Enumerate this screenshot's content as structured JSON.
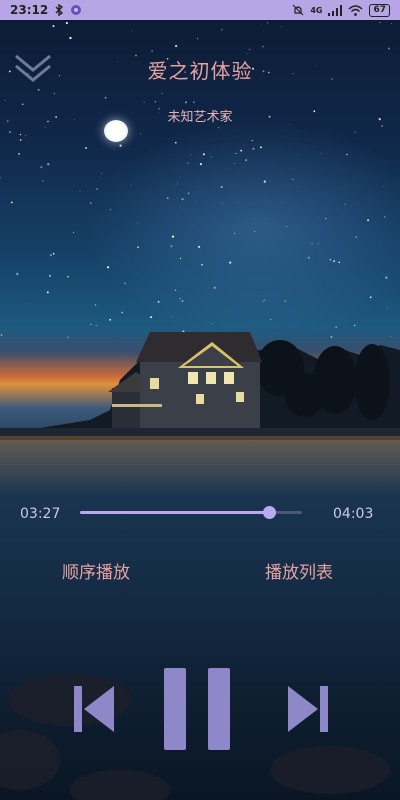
{
  "status_bar": {
    "time": "23:12",
    "signal": "4G",
    "battery": "67"
  },
  "header": {
    "collapse_icon": "double-chevron-down-icon",
    "song_title": "爱之初体验",
    "artist": "未知艺术家"
  },
  "progress": {
    "current_time": "03:27",
    "total_time": "04:03",
    "fraction": 0.852
  },
  "modes": {
    "order_label": "顺序播放",
    "playlist_label": "播放列表"
  },
  "controls": {
    "prev_icon": "skip-previous-icon",
    "pause_icon": "pause-icon",
    "next_icon": "skip-next-icon"
  },
  "colors": {
    "status_bar": "#b7a6e6",
    "accent": "#b8a9f0",
    "title": "#e9a0a0",
    "control": "#8f88c8"
  }
}
